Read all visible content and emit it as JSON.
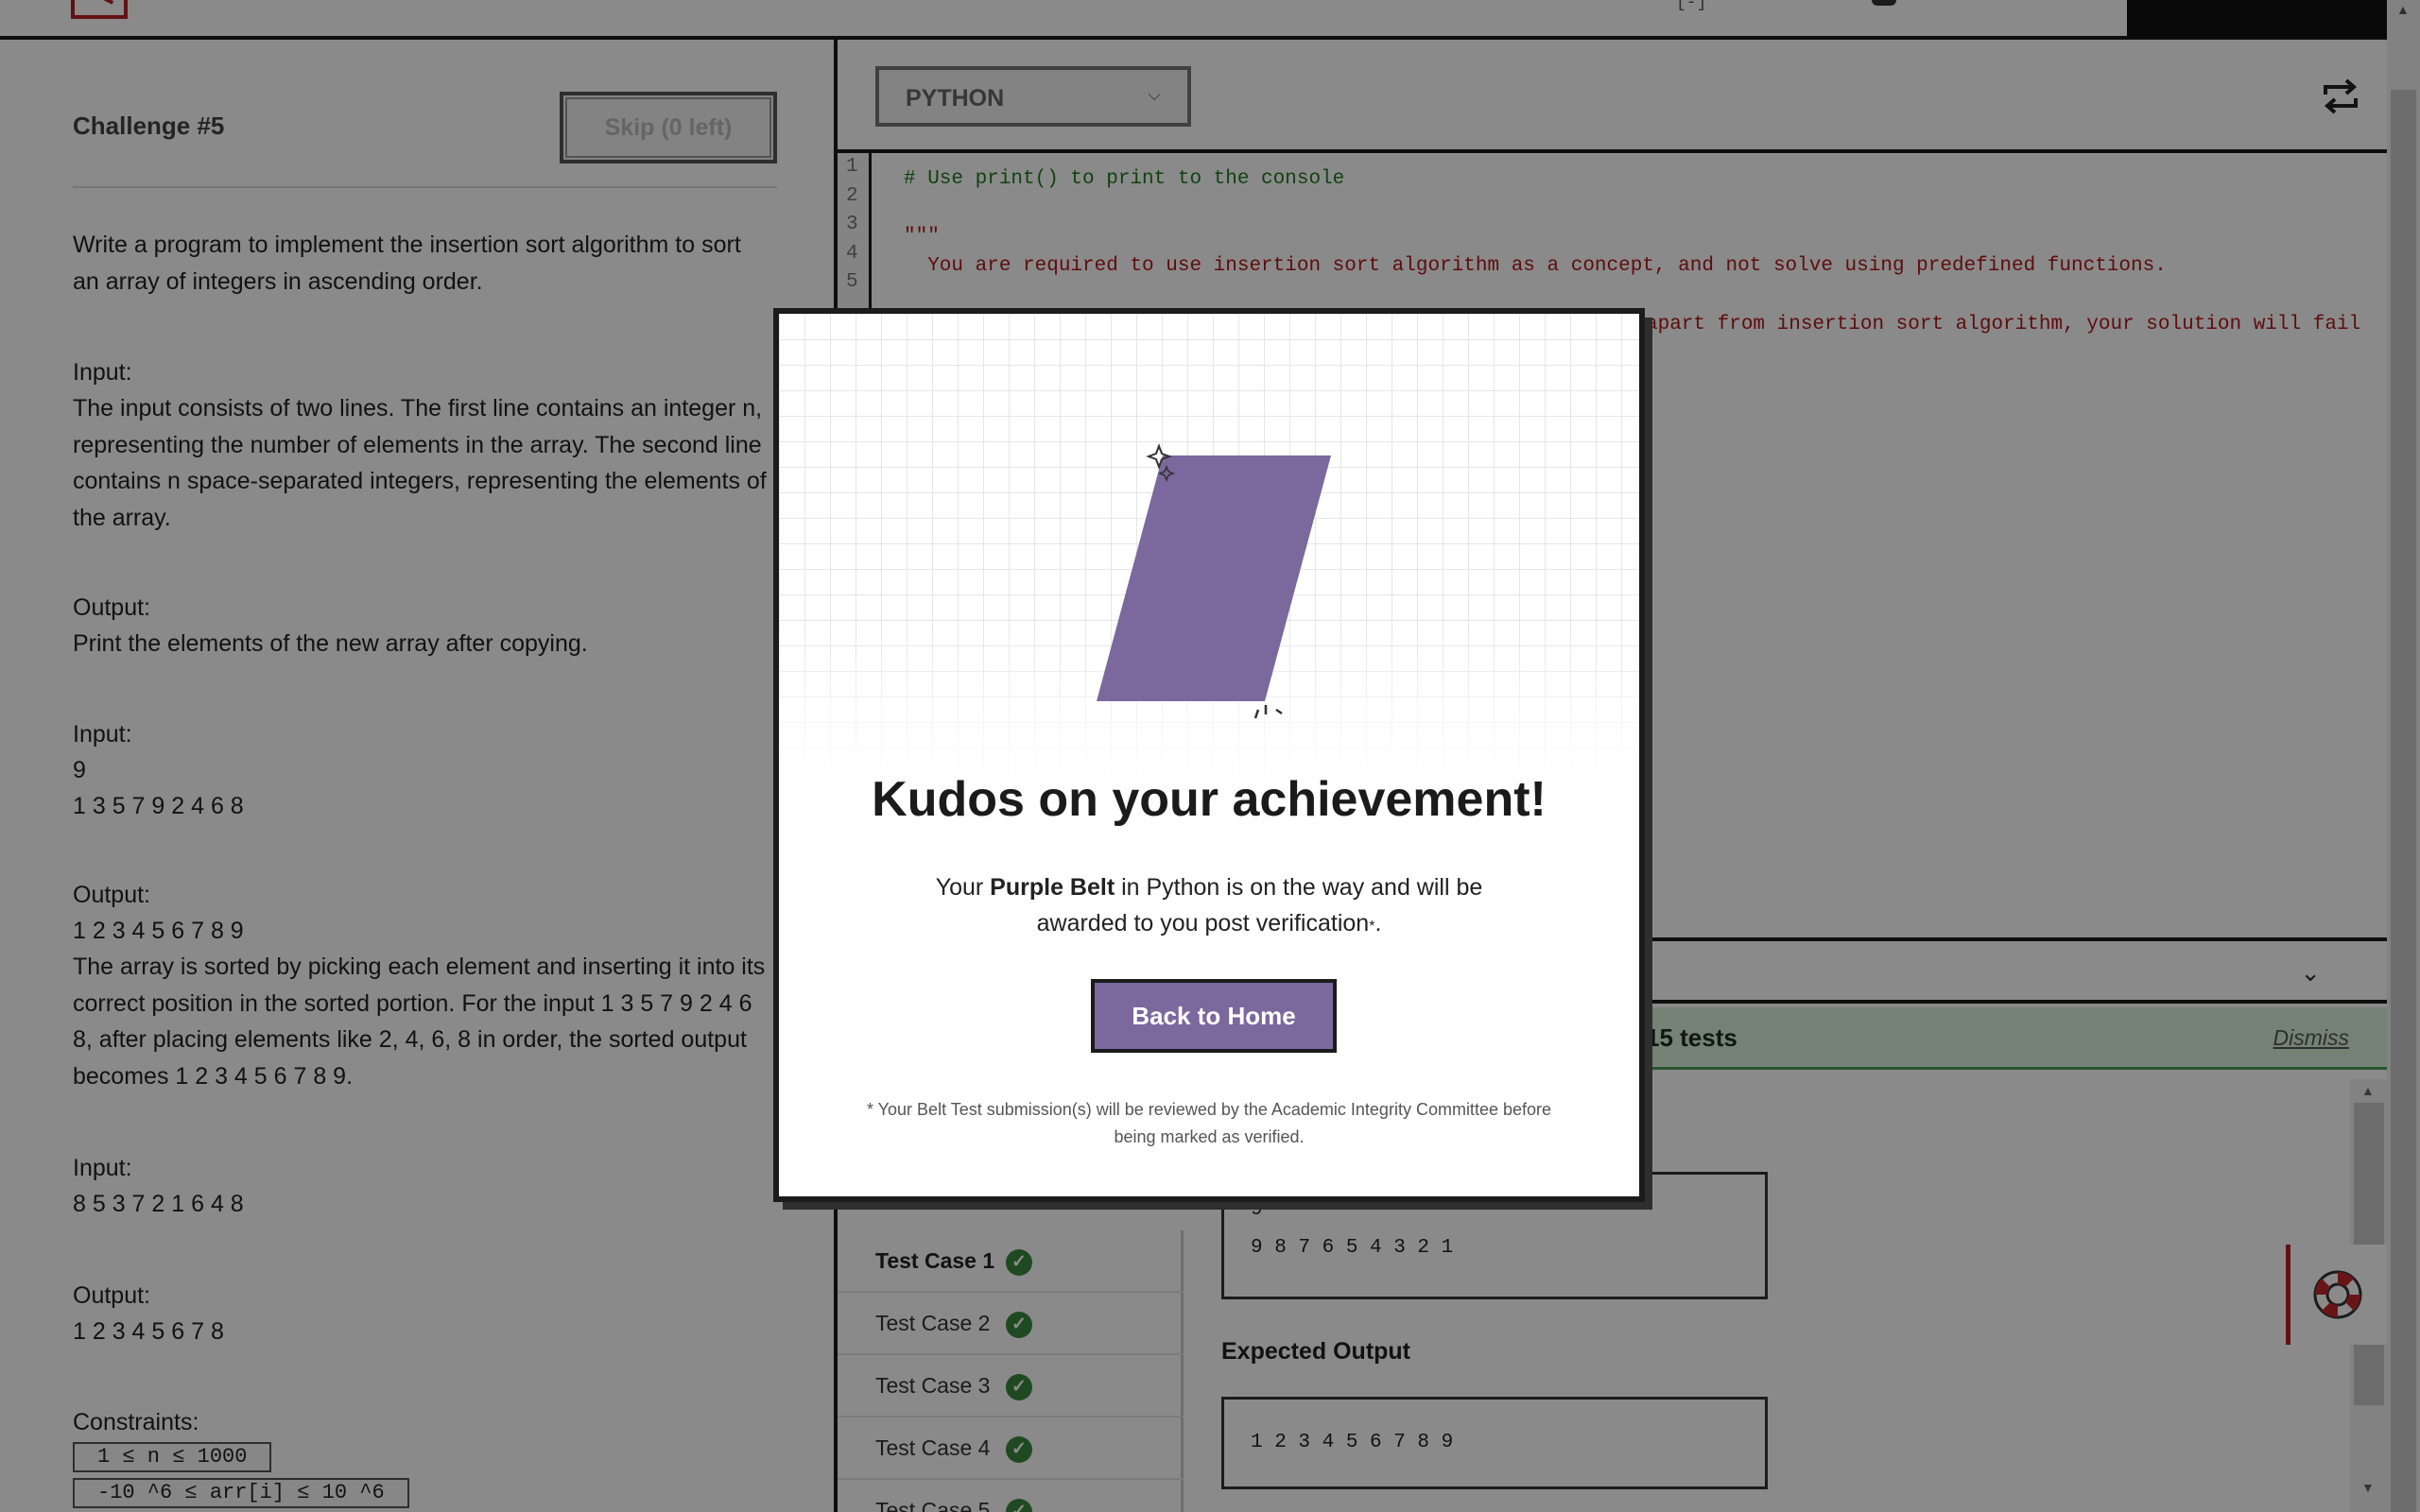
{
  "topbar": {
    "bracket_text": "[-]"
  },
  "challenge": {
    "title": "Challenge #5",
    "skip_label": "Skip (0 left)",
    "description": "Write a program to implement the insertion sort algorithm to sort an array of integers in ascending order.",
    "input_heading": "Input:",
    "input_text": "The input consists of two lines. The first line contains an integer n, representing the number of elements in the array. The second line contains n space-separated integers, representing the elements of the array.",
    "output_heading": "Output:",
    "output_text": "Print the elements of the new array after copying.",
    "examples": [
      {
        "input_heading": "Input:",
        "input_line1": "9",
        "input_line2": "1 3 5 7 9 2 4 6 8",
        "output_heading": "Output:",
        "output_line": "1 2 3 4 5 6 7 8 9",
        "explanation": "The array is sorted by picking each element and inserting it into its correct position in the sorted portion. For the input 1 3 5 7 9 2 4 6 8, after placing elements like 2, 4, 6, 8 in order, the sorted output becomes 1 2 3 4 5 6 7 8 9."
      },
      {
        "input_heading": "Input:",
        "input_line": "8 5 3 7 2 1 6 4 8",
        "output_heading": "Output:",
        "output_line": "1 2 3 4 5 6 7 8"
      }
    ],
    "constraints_heading": "Constraints:",
    "constraints": [
      "1 ≤ n ≤ 1000",
      "-10 ^6 ≤ arr[i] ≤ 10 ^6"
    ]
  },
  "editor": {
    "language": "PYTHON",
    "line_numbers": [
      "1",
      "2",
      "3",
      "4",
      "5"
    ],
    "code_lines": [
      "# Use print() to print to the console",
      "\"\"\"",
      "  You are required to use insertion sort algorithm as a concept, and not solve using predefined functions.",
      "apart from insertion sort algorithm, your solution will fail"
    ]
  },
  "results": {
    "banner_text": "15 tests",
    "dismiss_label": "Dismiss",
    "test_cases": [
      "Test Case 1",
      "Test Case 2",
      "Test Case 3",
      "Test Case 4",
      "Test Case 5"
    ],
    "input_line1": "9",
    "input_line2": "9 8 7 6 5 4 3 2 1",
    "expected_output_title": "Expected Output",
    "expected_output": "1 2 3 4 5 6 7 8 9"
  },
  "modal": {
    "title": "Kudos on your achievement!",
    "msg_prefix": "Your ",
    "belt_name": "Purple Belt",
    "msg_middle": " in Python is on the way and will be awarded to you post verification",
    "asterisk": "*",
    "msg_suffix": ".",
    "button_label": "Back to Home",
    "note": "* Your Belt Test submission(s) will be reviewed by the Academic Integrity Committee before being marked as verified.",
    "belt_color": "#7b689d"
  },
  "icons": {
    "select_chevron": "chevron-down-icon",
    "swap": "swap-icon",
    "console_chevron": "chevron-down-icon",
    "check": "check-circle-icon",
    "help": "lifebuoy-icon"
  }
}
